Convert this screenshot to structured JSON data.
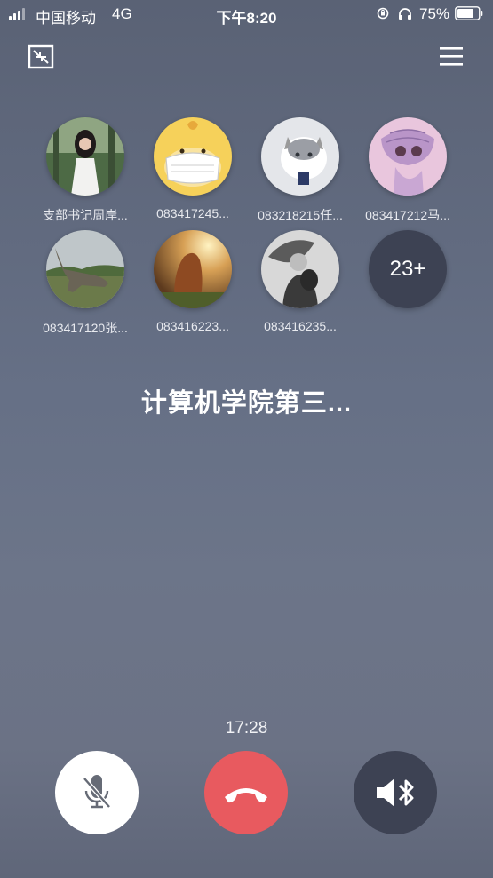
{
  "status_bar": {
    "carrier": "中国移动",
    "network": "4G",
    "time": "下午8:20",
    "battery": "75%"
  },
  "participants": [
    {
      "name": "支部书记周岸..."
    },
    {
      "name": "083417245..."
    },
    {
      "name": "083218215任..."
    },
    {
      "name": "083417212马..."
    },
    {
      "name": "083417120张..."
    },
    {
      "name": "083416223..."
    },
    {
      "name": "083416235..."
    }
  ],
  "more_count": "23+",
  "group_name": "计算机学院第三...",
  "call_duration": "17:28",
  "colors": {
    "hangup": "#e85a5f",
    "dark_button": "#3d4253",
    "background": "#667086"
  },
  "icons": {
    "minimize": "minimize-icon",
    "menu": "menu-icon",
    "mute": "mic-muted-icon",
    "hangup": "phone-hangup-icon",
    "speaker": "bluetooth-speaker-icon"
  }
}
